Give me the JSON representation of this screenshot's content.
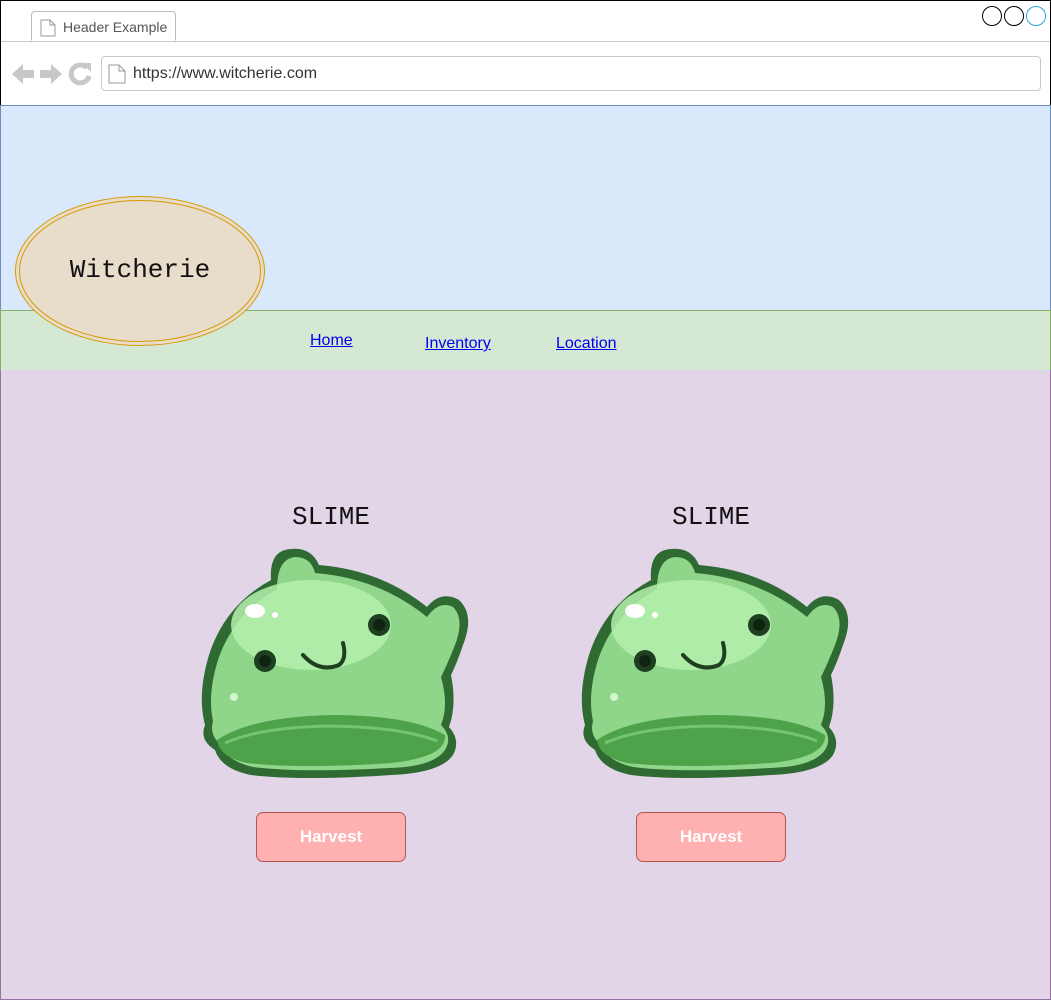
{
  "browser": {
    "tab_title": "Header Example",
    "url": "https://www.witcherie.com"
  },
  "site": {
    "logo_text": "Witcherie",
    "nav": [
      {
        "label": "Home"
      },
      {
        "label": "Inventory"
      },
      {
        "label": "Location"
      }
    ]
  },
  "cards": [
    {
      "title": "SLIME",
      "button_label": "Harvest"
    },
    {
      "title": "SLIME",
      "button_label": "Harvest"
    }
  ],
  "colors": {
    "header_bg": "#dae8fc",
    "nav_bg": "#d5e8d4",
    "content_bg": "#e1d5e7",
    "logo_bg": "#e8dccb",
    "button_bg": "#ffb0b0",
    "slime_green": "#7ecb74"
  }
}
